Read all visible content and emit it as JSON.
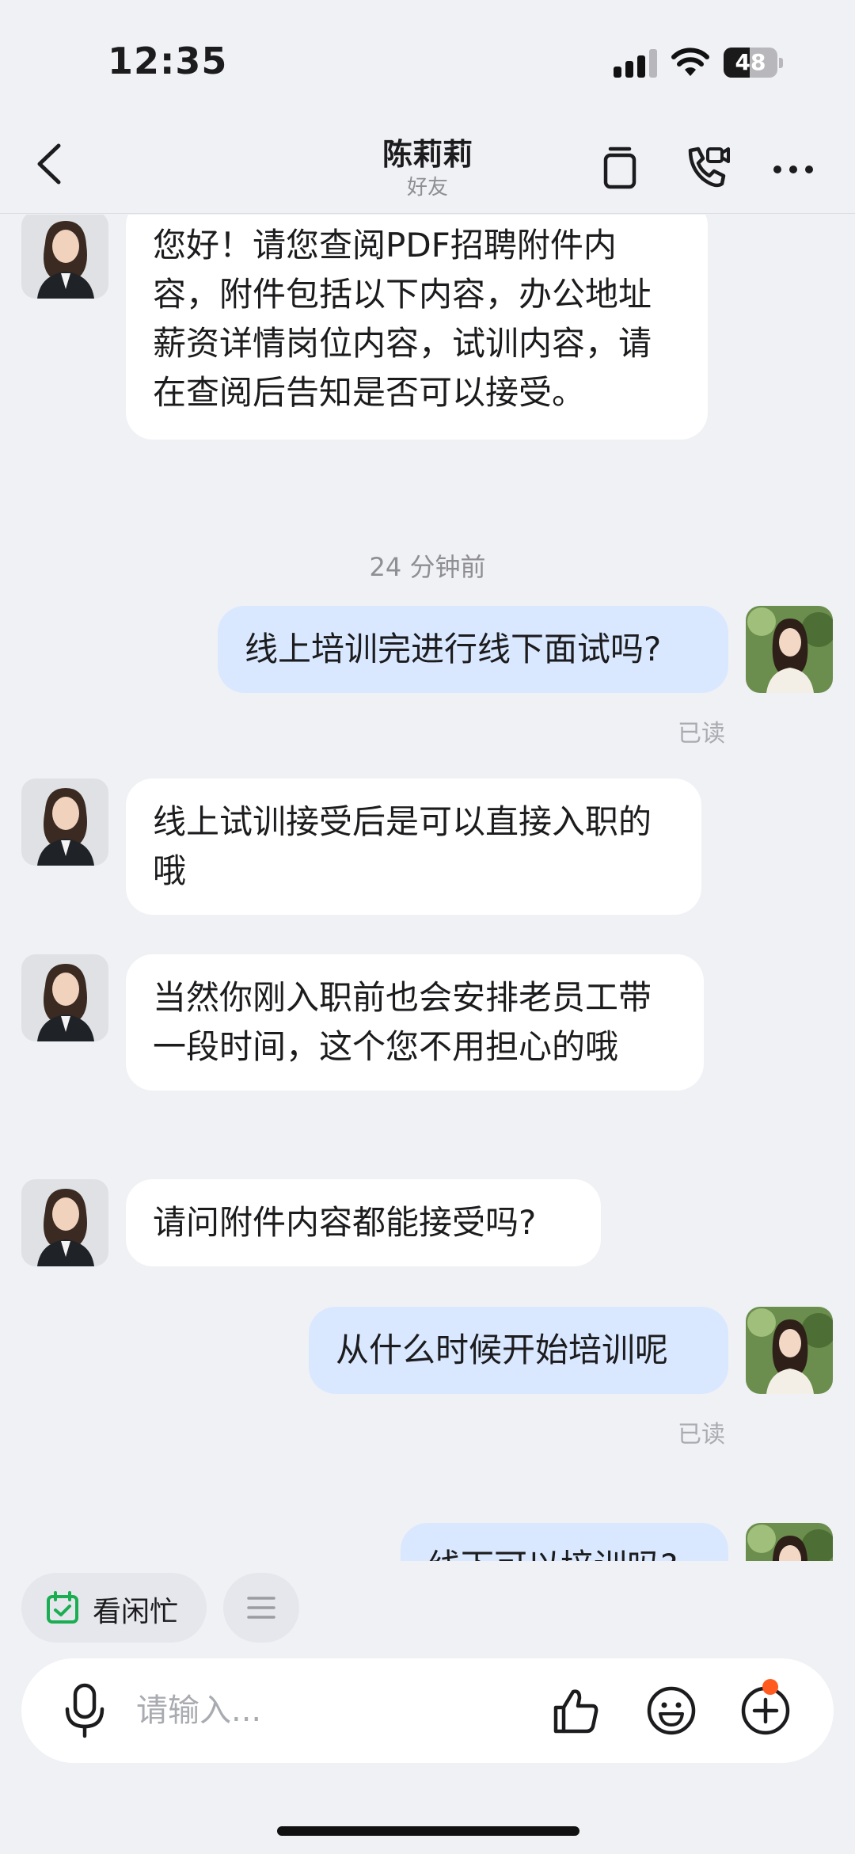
{
  "status_bar": {
    "time": "12:35",
    "battery": "48",
    "battery_level": 0.48
  },
  "header": {
    "back_icon": "chevron-left-icon",
    "title": "陈莉莉",
    "subtitle": "好友",
    "icons": [
      "copy-icon",
      "video-call-icon",
      "more-icon"
    ]
  },
  "messages": [
    {
      "side": "in",
      "text": "您好！请您查阅PDF招聘附件内容，附件包括以下内容，办公地址薪资详情岗位内容，试训内容，请在查阅后告知是否可以接受。"
    },
    {
      "type": "timestamp",
      "text": "24 分钟前"
    },
    {
      "side": "out",
      "text": "线上培训完进行线下面试吗?",
      "status": "已读"
    },
    {
      "side": "in",
      "text": "线上试训接受后是可以直接入职的哦"
    },
    {
      "side": "in",
      "text": "当然你刚入职前也会安排老员工带一段时间，这个您不用担心的哦"
    },
    {
      "side": "in",
      "text": "请问附件内容都能接受吗?"
    },
    {
      "side": "out",
      "text": "从什么时候开始培训呢",
      "status": "已读"
    },
    {
      "side": "out",
      "text": "线下可以培训吗?"
    }
  ],
  "quick_actions": {
    "schedule_label": "看闲忙"
  },
  "input_bar": {
    "placeholder": "请输入...",
    "icons": [
      "microphone-icon",
      "thumbs-up-icon",
      "emoji-icon",
      "add-circle-icon"
    ]
  },
  "colors": {
    "background": "#eff1f5",
    "incoming_bubble": "#ffffff",
    "outgoing_bubble": "#d9e8ff",
    "badge": "#ff5a1f",
    "accent_green": "#1aad52"
  }
}
